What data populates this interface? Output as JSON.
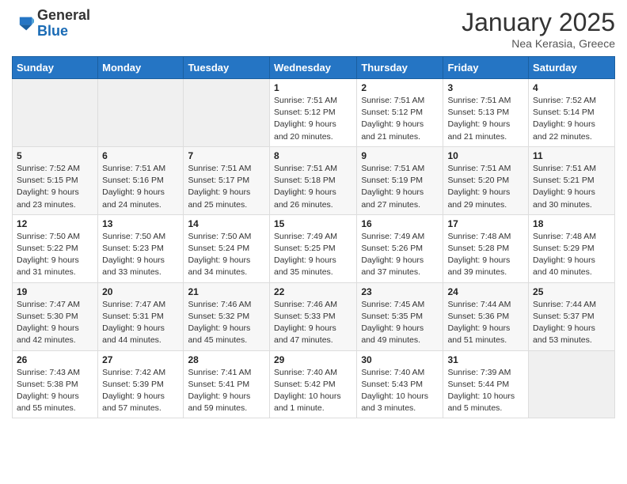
{
  "header": {
    "logo_general": "General",
    "logo_blue": "Blue",
    "month": "January 2025",
    "location": "Nea Kerasia, Greece"
  },
  "days_of_week": [
    "Sunday",
    "Monday",
    "Tuesday",
    "Wednesday",
    "Thursday",
    "Friday",
    "Saturday"
  ],
  "weeks": [
    [
      {
        "day": "",
        "content": ""
      },
      {
        "day": "",
        "content": ""
      },
      {
        "day": "",
        "content": ""
      },
      {
        "day": "1",
        "content": "Sunrise: 7:51 AM\nSunset: 5:12 PM\nDaylight: 9 hours\nand 20 minutes."
      },
      {
        "day": "2",
        "content": "Sunrise: 7:51 AM\nSunset: 5:12 PM\nDaylight: 9 hours\nand 21 minutes."
      },
      {
        "day": "3",
        "content": "Sunrise: 7:51 AM\nSunset: 5:13 PM\nDaylight: 9 hours\nand 21 minutes."
      },
      {
        "day": "4",
        "content": "Sunrise: 7:52 AM\nSunset: 5:14 PM\nDaylight: 9 hours\nand 22 minutes."
      }
    ],
    [
      {
        "day": "5",
        "content": "Sunrise: 7:52 AM\nSunset: 5:15 PM\nDaylight: 9 hours\nand 23 minutes."
      },
      {
        "day": "6",
        "content": "Sunrise: 7:51 AM\nSunset: 5:16 PM\nDaylight: 9 hours\nand 24 minutes."
      },
      {
        "day": "7",
        "content": "Sunrise: 7:51 AM\nSunset: 5:17 PM\nDaylight: 9 hours\nand 25 minutes."
      },
      {
        "day": "8",
        "content": "Sunrise: 7:51 AM\nSunset: 5:18 PM\nDaylight: 9 hours\nand 26 minutes."
      },
      {
        "day": "9",
        "content": "Sunrise: 7:51 AM\nSunset: 5:19 PM\nDaylight: 9 hours\nand 27 minutes."
      },
      {
        "day": "10",
        "content": "Sunrise: 7:51 AM\nSunset: 5:20 PM\nDaylight: 9 hours\nand 29 minutes."
      },
      {
        "day": "11",
        "content": "Sunrise: 7:51 AM\nSunset: 5:21 PM\nDaylight: 9 hours\nand 30 minutes."
      }
    ],
    [
      {
        "day": "12",
        "content": "Sunrise: 7:50 AM\nSunset: 5:22 PM\nDaylight: 9 hours\nand 31 minutes."
      },
      {
        "day": "13",
        "content": "Sunrise: 7:50 AM\nSunset: 5:23 PM\nDaylight: 9 hours\nand 33 minutes."
      },
      {
        "day": "14",
        "content": "Sunrise: 7:50 AM\nSunset: 5:24 PM\nDaylight: 9 hours\nand 34 minutes."
      },
      {
        "day": "15",
        "content": "Sunrise: 7:49 AM\nSunset: 5:25 PM\nDaylight: 9 hours\nand 35 minutes."
      },
      {
        "day": "16",
        "content": "Sunrise: 7:49 AM\nSunset: 5:26 PM\nDaylight: 9 hours\nand 37 minutes."
      },
      {
        "day": "17",
        "content": "Sunrise: 7:48 AM\nSunset: 5:28 PM\nDaylight: 9 hours\nand 39 minutes."
      },
      {
        "day": "18",
        "content": "Sunrise: 7:48 AM\nSunset: 5:29 PM\nDaylight: 9 hours\nand 40 minutes."
      }
    ],
    [
      {
        "day": "19",
        "content": "Sunrise: 7:47 AM\nSunset: 5:30 PM\nDaylight: 9 hours\nand 42 minutes."
      },
      {
        "day": "20",
        "content": "Sunrise: 7:47 AM\nSunset: 5:31 PM\nDaylight: 9 hours\nand 44 minutes."
      },
      {
        "day": "21",
        "content": "Sunrise: 7:46 AM\nSunset: 5:32 PM\nDaylight: 9 hours\nand 45 minutes."
      },
      {
        "day": "22",
        "content": "Sunrise: 7:46 AM\nSunset: 5:33 PM\nDaylight: 9 hours\nand 47 minutes."
      },
      {
        "day": "23",
        "content": "Sunrise: 7:45 AM\nSunset: 5:35 PM\nDaylight: 9 hours\nand 49 minutes."
      },
      {
        "day": "24",
        "content": "Sunrise: 7:44 AM\nSunset: 5:36 PM\nDaylight: 9 hours\nand 51 minutes."
      },
      {
        "day": "25",
        "content": "Sunrise: 7:44 AM\nSunset: 5:37 PM\nDaylight: 9 hours\nand 53 minutes."
      }
    ],
    [
      {
        "day": "26",
        "content": "Sunrise: 7:43 AM\nSunset: 5:38 PM\nDaylight: 9 hours\nand 55 minutes."
      },
      {
        "day": "27",
        "content": "Sunrise: 7:42 AM\nSunset: 5:39 PM\nDaylight: 9 hours\nand 57 minutes."
      },
      {
        "day": "28",
        "content": "Sunrise: 7:41 AM\nSunset: 5:41 PM\nDaylight: 9 hours\nand 59 minutes."
      },
      {
        "day": "29",
        "content": "Sunrise: 7:40 AM\nSunset: 5:42 PM\nDaylight: 10 hours\nand 1 minute."
      },
      {
        "day": "30",
        "content": "Sunrise: 7:40 AM\nSunset: 5:43 PM\nDaylight: 10 hours\nand 3 minutes."
      },
      {
        "day": "31",
        "content": "Sunrise: 7:39 AM\nSunset: 5:44 PM\nDaylight: 10 hours\nand 5 minutes."
      },
      {
        "day": "",
        "content": ""
      }
    ]
  ]
}
